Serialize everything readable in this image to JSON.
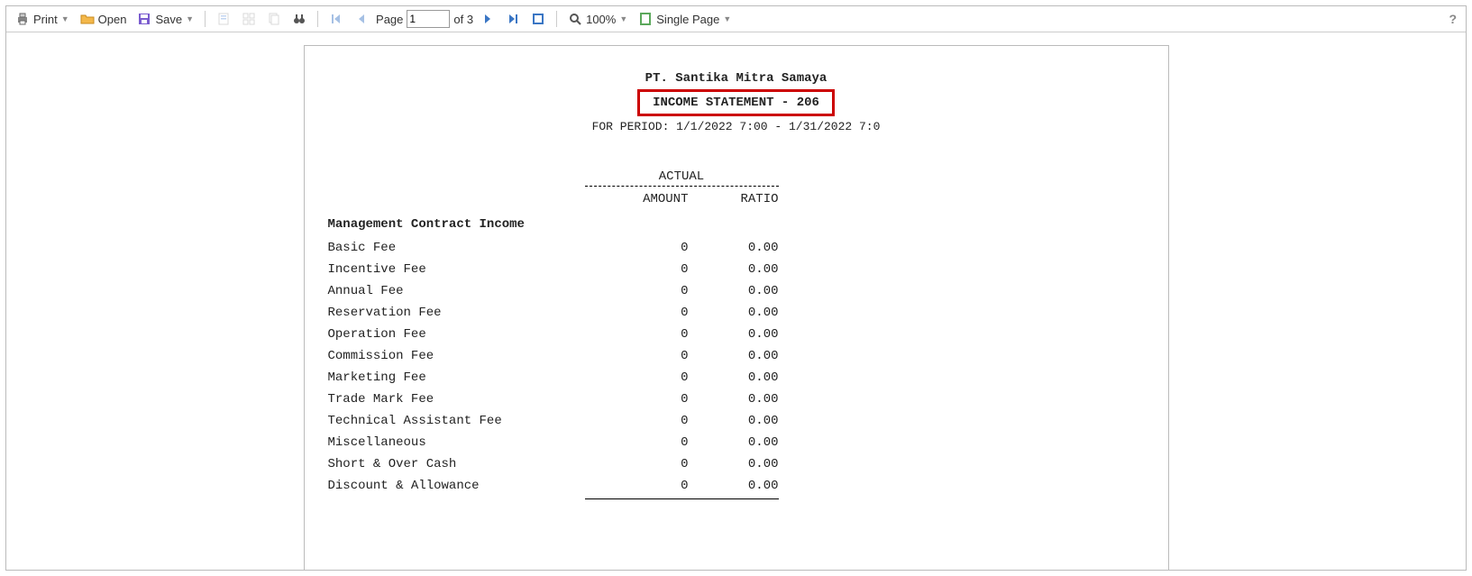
{
  "toolbar": {
    "print": "Print",
    "open": "Open",
    "save": "Save",
    "page_label": "Page",
    "page_value": "1",
    "page_total": "of 3",
    "zoom": "100%",
    "view_mode": "Single Page"
  },
  "help": "?",
  "doc": {
    "company": "PT. Santika Mitra Samaya",
    "title": "INCOME STATEMENT - 206",
    "period": "FOR PERIOD:  1/1/2022 7:00 - 1/31/2022 7:0",
    "actual_label": "ACTUAL",
    "col_amount": "AMOUNT",
    "col_ratio": "RATIO",
    "section": "Management Contract Income",
    "rows": [
      {
        "desc": "Basic Fee",
        "amt": "0",
        "rat": "0.00"
      },
      {
        "desc": "Incentive Fee",
        "amt": "0",
        "rat": "0.00"
      },
      {
        "desc": "Annual Fee",
        "amt": "0",
        "rat": "0.00"
      },
      {
        "desc": "Reservation Fee",
        "amt": "0",
        "rat": "0.00"
      },
      {
        "desc": "Operation Fee",
        "amt": "0",
        "rat": "0.00"
      },
      {
        "desc": "Commission Fee",
        "amt": "0",
        "rat": "0.00"
      },
      {
        "desc": "Marketing Fee",
        "amt": "0",
        "rat": "0.00"
      },
      {
        "desc": "Trade Mark Fee",
        "amt": "0",
        "rat": "0.00"
      },
      {
        "desc": "Technical Assistant Fee",
        "amt": "0",
        "rat": "0.00"
      },
      {
        "desc": "Miscellaneous",
        "amt": "0",
        "rat": "0.00"
      },
      {
        "desc": "Short & Over Cash",
        "amt": "0",
        "rat": "0.00"
      },
      {
        "desc": "Discount & Allowance",
        "amt": "0",
        "rat": "0.00"
      }
    ]
  }
}
